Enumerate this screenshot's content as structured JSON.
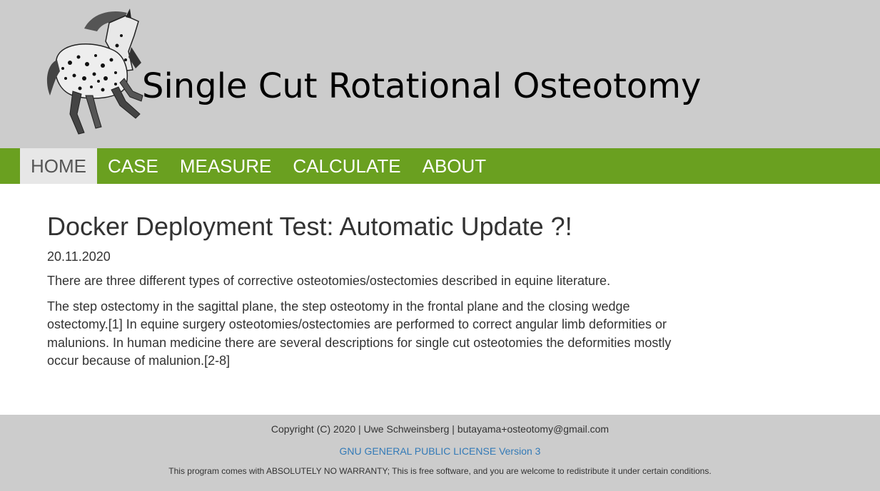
{
  "header": {
    "title": "Single Cut Rotational Osteotomy",
    "logo_icon": "horse-logo-icon",
    "background": "#cccccc"
  },
  "nav": {
    "background": "#6aa020",
    "items": [
      {
        "label": "HOME",
        "active": true
      },
      {
        "label": "CASE",
        "active": false
      },
      {
        "label": "MEASURE",
        "active": false
      },
      {
        "label": "CALCULATE",
        "active": false
      },
      {
        "label": "ABOUT",
        "active": false
      }
    ]
  },
  "post": {
    "title": "Docker Deployment Test: Automatic Update ?!",
    "date": "20.11.2020",
    "paragraphs": [
      "There are three different types of corrective osteotomies/ostectomies described in equine literature.",
      "The step ostectomy in the sagittal plane, the step osteotomy in the frontal plane and the closing wedge ostectomy.[1] In equine surgery osteotomies/ostectomies are performed to correct angular limb deformities or malunions. In human medicine there are several descriptions for single cut osteotomies the deformities mostly occur because of malunion.[2-8]"
    ]
  },
  "footer": {
    "copyright": "Copyright (C) 2020 | Uwe Schweinsberg | butayama+osteotomy@gmail.com",
    "license_link": "GNU GENERAL PUBLIC LICENSE Version 3",
    "warranty": "This program comes with ABSOLUTELY NO WARRANTY; This is free software, and you are welcome to redistribute it under certain conditions.",
    "link_color": "#337ab7"
  }
}
